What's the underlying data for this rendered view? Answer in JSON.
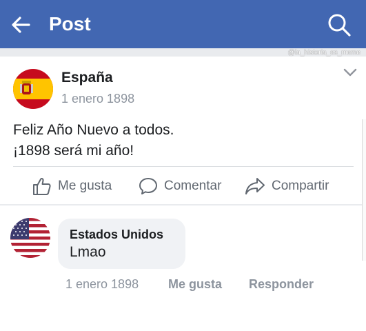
{
  "header": {
    "title": "Post",
    "back_icon": "arrow-left-icon",
    "search_icon": "search-icon",
    "watermark": "@la_historia_es_meme",
    "bar_color": "#4267b2"
  },
  "post": {
    "author": "España",
    "date": "1 enero 1898",
    "avatar_icon": "spain-flag-icon",
    "text_line1": "Feliz Año Nuevo a todos.",
    "text_line2": "¡1898 será mi año!",
    "options_icon": "chevron-down-icon",
    "actions": {
      "like": "Me gusta",
      "comment": "Comentar",
      "share": "Compartir"
    }
  },
  "comment": {
    "author": "Estados Unidos",
    "avatar_icon": "usa-flag-icon",
    "text": "Lmao",
    "date": "1 enero 1898",
    "like": "Me gusta",
    "reply": "Responder"
  }
}
